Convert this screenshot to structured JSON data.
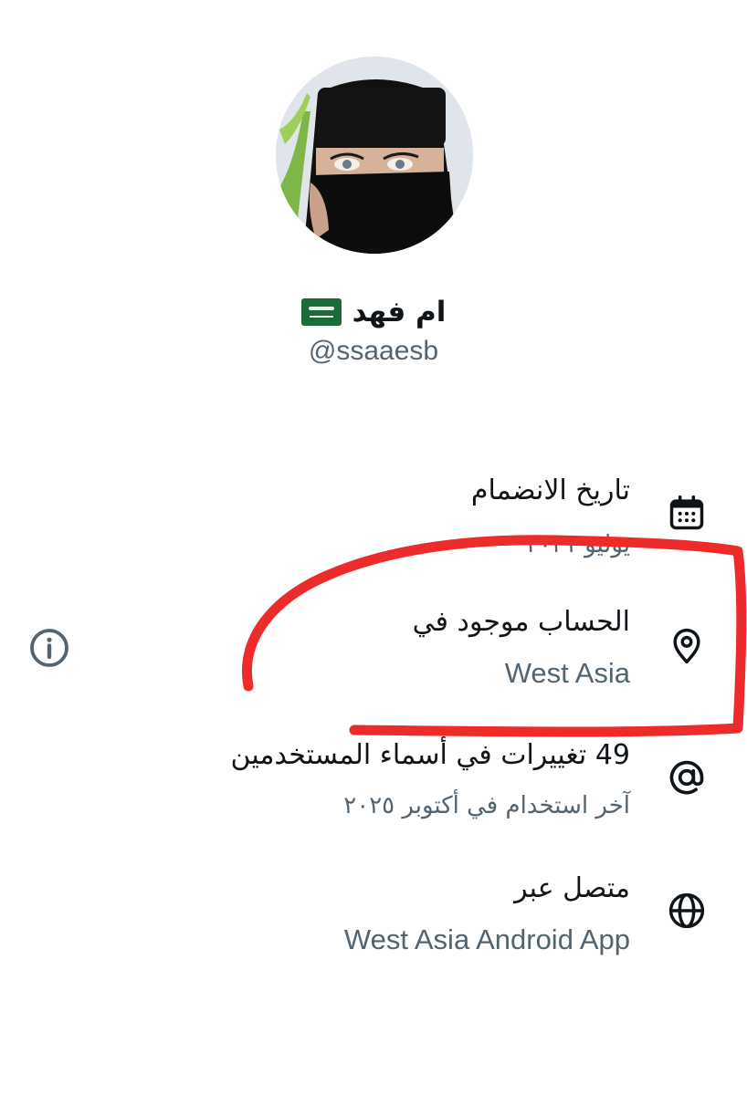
{
  "profile": {
    "display_name": "ام فهد",
    "flag_icon": "saudi-arabia-flag",
    "handle": "@ssaaesb"
  },
  "about_rows": [
    {
      "icon": "calendar-icon",
      "title": "تاريخ الانضمام",
      "value": "يوليو ٢٠٢١"
    },
    {
      "icon": "location-pin-icon",
      "title": "الحساب موجود في",
      "value": "West Asia"
    },
    {
      "icon": "at-sign-icon",
      "title": "49 تغييرات في أسماء المستخدمين",
      "value": "آخر استخدام في أكتوبر ٢٠٢٥"
    },
    {
      "icon": "globe-icon",
      "title": "متصل عبر",
      "value": "West Asia Android App"
    }
  ],
  "info_icon": "info-icon",
  "colors": {
    "primary_text": "#0f1419",
    "secondary_text": "#536471",
    "annotation_red": "#ee2b2b",
    "flag_green": "#1d6b3a"
  }
}
